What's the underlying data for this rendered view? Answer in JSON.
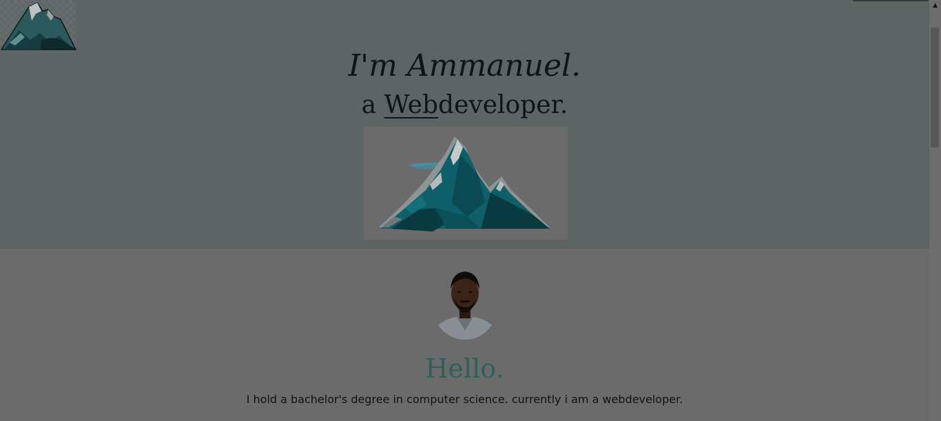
{
  "hero": {
    "headline": "I'm Ammanuel.",
    "subline_prefix": "a ",
    "subline_typed": "Web",
    "subline_suffix": "developer."
  },
  "about": {
    "greeting": "Hello.",
    "bio": "I hold a bachelor's degree in computer science. currently i am a webdeveloper."
  },
  "colors": {
    "hero_bg": "#5c6563",
    "about_bg": "#6b6b6b",
    "greeting": "#2e5f5c",
    "mountain_teal": "#0e5f69",
    "mountain_dark": "#093a40"
  },
  "icons": {
    "logo": "mountain-logo-icon",
    "hero_art": "mountain-illustration",
    "scroll_up": "scroll-up-arrow-icon"
  },
  "scroll": {
    "up_glyph": "▲"
  }
}
